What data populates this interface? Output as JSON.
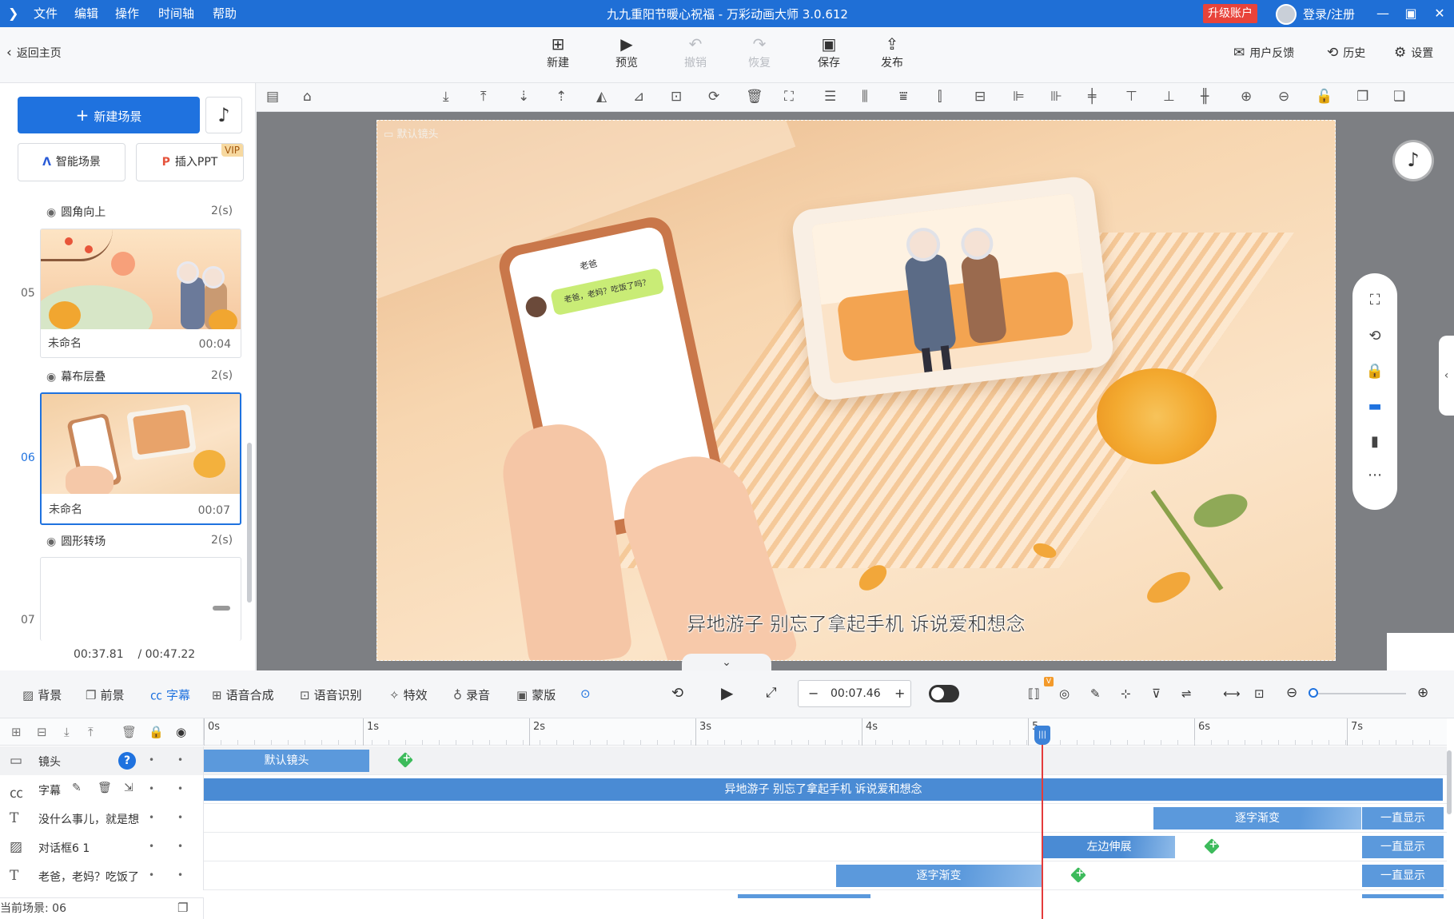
{
  "titlebar": {
    "menu": [
      "文件",
      "编辑",
      "操作",
      "时间轴",
      "帮助"
    ],
    "title": "九九重阳节暖心祝福 - 万彩动画大师 3.0.612",
    "upgrade": "升级账户",
    "login": "登录/注册"
  },
  "toolbar": {
    "back": "返回主页",
    "new": "新建",
    "preview": "预览",
    "undo": "撤销",
    "redo": "恢复",
    "save": "保存",
    "publish": "发布",
    "feedback": "用户反馈",
    "history": "历史",
    "settings": "设置"
  },
  "left": {
    "new_scene": "新建场景",
    "smart_scene": "智能场景",
    "insert_ppt": "插入PPT",
    "vip": "VIP",
    "scenes": [
      {
        "transition": "圆角向上",
        "trans_dur": "2(s)",
        "num": "05",
        "name": "未命名",
        "dur": "00:04"
      },
      {
        "transition": "幕布层叠",
        "trans_dur": "2(s)",
        "num": "06",
        "name": "未命名",
        "dur": "00:07"
      },
      {
        "transition": "圆形转场",
        "trans_dur": "2(s)",
        "num": "07",
        "name": "",
        "dur": ""
      }
    ],
    "current_time": "00:37.81",
    "total_time": "/ 00:47.22"
  },
  "canvas": {
    "camera_label": "默认镜头",
    "phone_contact": "老爸",
    "chat_bubble": "老爸，老妈？吃饭了吗？",
    "subtitle": "异地游子 别忘了拿起手机 诉说爱和想念"
  },
  "bottombar": {
    "tabs": [
      "背景",
      "前景",
      "字幕",
      "语音合成",
      "语音识别",
      "特效",
      "录音",
      "蒙版"
    ],
    "active_tab": "字幕",
    "time": "00:07.46",
    "minus": "−",
    "plus": "+"
  },
  "timeline": {
    "ticks": [
      "0s",
      "1s",
      "2s",
      "3s",
      "4s",
      "5",
      "6s",
      "7s"
    ],
    "rows": [
      {
        "icon": "camera",
        "name": "镜头"
      },
      {
        "icon": "caption",
        "name": "字幕"
      },
      {
        "icon": "text",
        "name": "没什么事儿，就是想"
      },
      {
        "icon": "image",
        "name": "对话框6 1"
      },
      {
        "icon": "text",
        "name": "老爸，老妈？吃饭了"
      }
    ],
    "clips": {
      "camera": "默认镜头",
      "caption": "异地游子 别忘了拿起手机 诉说爱和想念",
      "fade_in": "逐字渐变",
      "always": "一直显示",
      "left_expand": "左边伸展"
    },
    "current_scene": "当前场景: 06"
  },
  "colors": {
    "accent": "#1f72df",
    "titlebar": "#1f6fd6",
    "upgrade": "#e8433a",
    "clip": "#5b99dc",
    "playhead": "#e43b3b",
    "keyframe": "#3dbb5c"
  }
}
